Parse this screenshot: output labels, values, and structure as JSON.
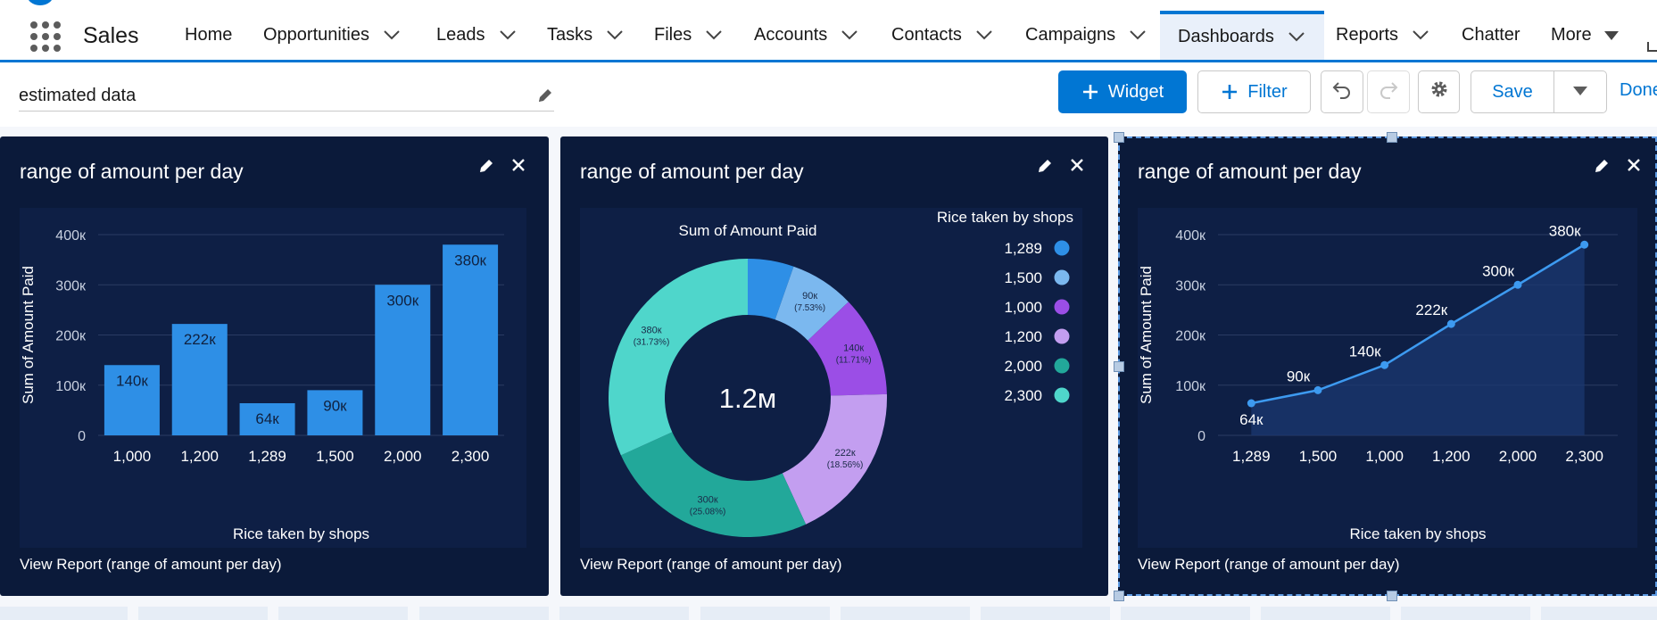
{
  "app": {
    "name": "Sales"
  },
  "nav": {
    "items": [
      {
        "label": "Home",
        "has_menu": false
      },
      {
        "label": "Opportunities",
        "has_menu": true
      },
      {
        "label": "Leads",
        "has_menu": true
      },
      {
        "label": "Tasks",
        "has_menu": true
      },
      {
        "label": "Files",
        "has_menu": true
      },
      {
        "label": "Accounts",
        "has_menu": true
      },
      {
        "label": "Contacts",
        "has_menu": true
      },
      {
        "label": "Campaigns",
        "has_menu": true
      },
      {
        "label": "Dashboards",
        "has_menu": true,
        "active": true
      },
      {
        "label": "Reports",
        "has_menu": true
      },
      {
        "label": "Chatter",
        "has_menu": false
      },
      {
        "label": "More",
        "has_menu": true
      }
    ]
  },
  "toolbar": {
    "dashboard_title": "estimated data",
    "widget_label": "Widget",
    "filter_label": "Filter",
    "save_label": "Save",
    "done_label": "Done"
  },
  "colors": {
    "brand": "#0176d3",
    "widget_bg": "#0b1a3a",
    "chart_bg": "#0e1f45",
    "bar": "#2e8fe6",
    "line": "#3d9af0"
  },
  "widgets": [
    {
      "title": "range of amount per day",
      "view_report": "View Report (range of amount per day)"
    },
    {
      "title": "range of amount per day",
      "view_report": "View Report (range of amount per day)"
    },
    {
      "title": "range of amount per day",
      "view_report": "View Report (range of amount per day)"
    }
  ],
  "chart_data": [
    {
      "type": "bar",
      "categories": [
        "1,000",
        "1,200",
        "1,289",
        "1,500",
        "2,000",
        "2,300"
      ],
      "values": [
        140000,
        222000,
        64000,
        90000,
        300000,
        380000
      ],
      "data_labels": [
        "140к",
        "222к",
        "64к",
        "90к",
        "300к",
        "380к"
      ],
      "xlabel": "Rice taken by shops",
      "ylabel": "Sum of Amount Paid",
      "ylim": [
        0,
        400000
      ],
      "y_ticks": [
        0,
        100000,
        200000,
        300000,
        400000
      ],
      "y_tick_labels": [
        "0",
        "100к",
        "200к",
        "300к",
        "400к"
      ],
      "grid": true
    },
    {
      "type": "pie",
      "title": "Sum of Amount Paid",
      "center_label": "1.2м",
      "legend_title": "Rice taken by shops",
      "legend_position": "right",
      "slices": [
        {
          "label": "1,289",
          "value": 64000,
          "display": "",
          "percent": "",
          "color": "#2e8fe6"
        },
        {
          "label": "1,500",
          "value": 90000,
          "display": "90к",
          "percent": "(7.53%)",
          "color": "#7bb8ef"
        },
        {
          "label": "1,000",
          "value": 140000,
          "display": "140к",
          "percent": "(11.71%)",
          "color": "#9b4ee6"
        },
        {
          "label": "1,200",
          "value": 222000,
          "display": "222к",
          "percent": "(18.56%)",
          "color": "#c39ef0"
        },
        {
          "label": "2,000",
          "value": 300000,
          "display": "300к",
          "percent": "(25.08%)",
          "color": "#22a89a"
        },
        {
          "label": "2,300",
          "value": 380000,
          "display": "380к",
          "percent": "(31.73%)",
          "color": "#4fd6cb"
        }
      ]
    },
    {
      "type": "area",
      "categories": [
        "1,289",
        "1,500",
        "1,000",
        "1,200",
        "2,000",
        "2,300"
      ],
      "values": [
        64000,
        90000,
        140000,
        222000,
        300000,
        380000
      ],
      "data_labels": [
        "64к",
        "90к",
        "140к",
        "222к",
        "300к",
        "380к"
      ],
      "xlabel": "Rice taken by shops",
      "ylabel": "Sum of Amount Paid",
      "ylim": [
        0,
        400000
      ],
      "y_ticks": [
        0,
        100000,
        200000,
        300000,
        400000
      ],
      "y_tick_labels": [
        "0",
        "100к",
        "200к",
        "300к",
        "400к"
      ],
      "grid": true
    }
  ]
}
